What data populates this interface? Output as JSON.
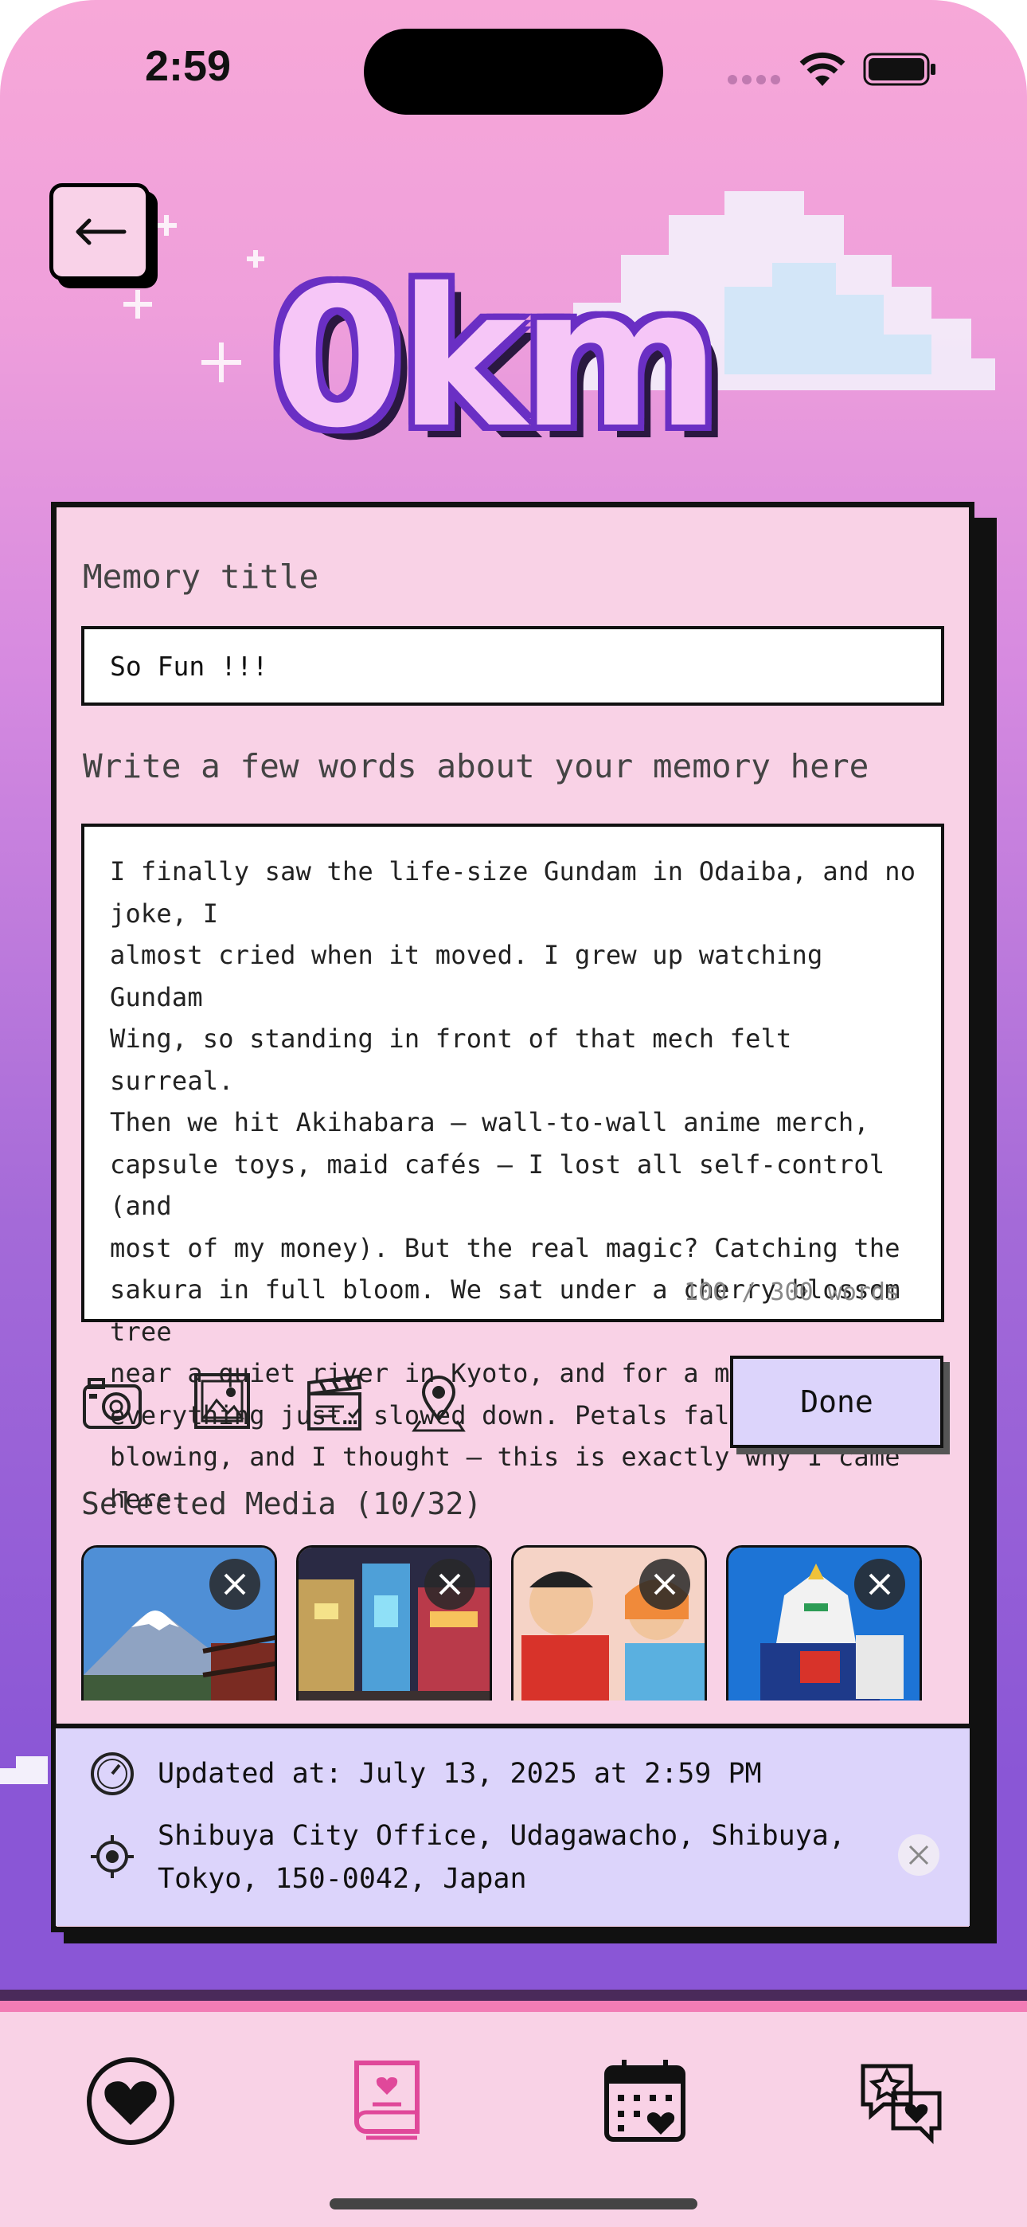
{
  "status_bar": {
    "time": "2:59"
  },
  "header": {
    "logo_text": "0km",
    "back_icon": "arrow-left-icon"
  },
  "form": {
    "title_label": "Memory title",
    "title_value": "So Fun !!!",
    "memory_label": "Write a few words about your memory here",
    "memory_lines": [
      "I finally saw the life-size Gundam in Odaiba, and no joke, I",
      "almost cried when it moved. I grew up watching Gundam",
      "Wing, so standing in front of that mech felt surreal.",
      "Then we hit Akihabara – wall-to-wall anime merch,",
      "capsule toys, maid cafés – I lost all self-control (and",
      "most of my money). But the real magic? Catching the",
      "sakura in full bloom. We sat under a cherry blossom tree",
      "near a quiet river in Kyoto, and for a moment,",
      "everything just… slowed down. Petals falling, breeze",
      "blowing, and I thought – this is exactly why I came here."
    ],
    "word_count": "100 / 300 words",
    "toolbar_icons": [
      "camera-icon",
      "image-icon",
      "clapperboard-icon",
      "location-pin-icon"
    ],
    "done_label": "Done"
  },
  "media": {
    "label": "Selected Media (10/32)",
    "items": [
      {
        "name": "mount-fuji-photo"
      },
      {
        "name": "city-night-photo"
      },
      {
        "name": "anime-poster-photo"
      },
      {
        "name": "gundam-photo"
      }
    ]
  },
  "info": {
    "updated": "Updated at: July 13, 2025 at 2:59 PM",
    "location_line1": "Shibuya City Office, Udagawacho, Shibuya,",
    "location_line2": "Tokyo, 150-0042, Japan"
  },
  "tabbar": {
    "tabs": [
      "heart-tab-icon",
      "journal-tab-icon",
      "calendar-tab-icon",
      "chat-tab-icon"
    ],
    "active": "journal-tab-icon"
  },
  "colors": {
    "card": "#f9d2e6",
    "panel": "#dcd4fb",
    "accent": "#f27cb5",
    "logo": "#6a2fc4"
  }
}
